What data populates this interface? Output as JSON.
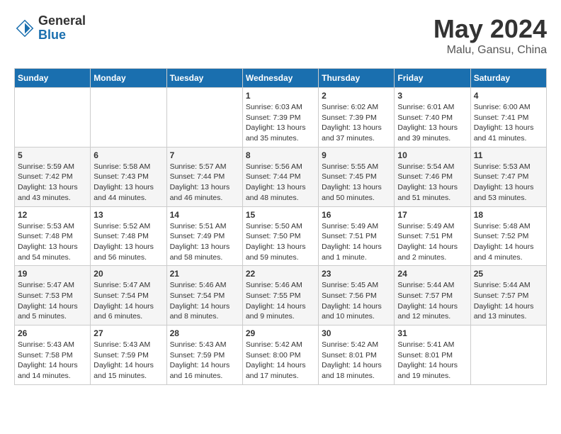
{
  "header": {
    "logo_general": "General",
    "logo_blue": "Blue",
    "title": "May 2024",
    "location": "Malu, Gansu, China"
  },
  "weekdays": [
    "Sunday",
    "Monday",
    "Tuesday",
    "Wednesday",
    "Thursday",
    "Friday",
    "Saturday"
  ],
  "weeks": [
    [
      {
        "day": "",
        "info": ""
      },
      {
        "day": "",
        "info": ""
      },
      {
        "day": "",
        "info": ""
      },
      {
        "day": "1",
        "info": "Sunrise: 6:03 AM\nSunset: 7:39 PM\nDaylight: 13 hours\nand 35 minutes."
      },
      {
        "day": "2",
        "info": "Sunrise: 6:02 AM\nSunset: 7:39 PM\nDaylight: 13 hours\nand 37 minutes."
      },
      {
        "day": "3",
        "info": "Sunrise: 6:01 AM\nSunset: 7:40 PM\nDaylight: 13 hours\nand 39 minutes."
      },
      {
        "day": "4",
        "info": "Sunrise: 6:00 AM\nSunset: 7:41 PM\nDaylight: 13 hours\nand 41 minutes."
      }
    ],
    [
      {
        "day": "5",
        "info": "Sunrise: 5:59 AM\nSunset: 7:42 PM\nDaylight: 13 hours\nand 43 minutes."
      },
      {
        "day": "6",
        "info": "Sunrise: 5:58 AM\nSunset: 7:43 PM\nDaylight: 13 hours\nand 44 minutes."
      },
      {
        "day": "7",
        "info": "Sunrise: 5:57 AM\nSunset: 7:44 PM\nDaylight: 13 hours\nand 46 minutes."
      },
      {
        "day": "8",
        "info": "Sunrise: 5:56 AM\nSunset: 7:44 PM\nDaylight: 13 hours\nand 48 minutes."
      },
      {
        "day": "9",
        "info": "Sunrise: 5:55 AM\nSunset: 7:45 PM\nDaylight: 13 hours\nand 50 minutes."
      },
      {
        "day": "10",
        "info": "Sunrise: 5:54 AM\nSunset: 7:46 PM\nDaylight: 13 hours\nand 51 minutes."
      },
      {
        "day": "11",
        "info": "Sunrise: 5:53 AM\nSunset: 7:47 PM\nDaylight: 13 hours\nand 53 minutes."
      }
    ],
    [
      {
        "day": "12",
        "info": "Sunrise: 5:53 AM\nSunset: 7:48 PM\nDaylight: 13 hours\nand 54 minutes."
      },
      {
        "day": "13",
        "info": "Sunrise: 5:52 AM\nSunset: 7:48 PM\nDaylight: 13 hours\nand 56 minutes."
      },
      {
        "day": "14",
        "info": "Sunrise: 5:51 AM\nSunset: 7:49 PM\nDaylight: 13 hours\nand 58 minutes."
      },
      {
        "day": "15",
        "info": "Sunrise: 5:50 AM\nSunset: 7:50 PM\nDaylight: 13 hours\nand 59 minutes."
      },
      {
        "day": "16",
        "info": "Sunrise: 5:49 AM\nSunset: 7:51 PM\nDaylight: 14 hours\nand 1 minute."
      },
      {
        "day": "17",
        "info": "Sunrise: 5:49 AM\nSunset: 7:51 PM\nDaylight: 14 hours\nand 2 minutes."
      },
      {
        "day": "18",
        "info": "Sunrise: 5:48 AM\nSunset: 7:52 PM\nDaylight: 14 hours\nand 4 minutes."
      }
    ],
    [
      {
        "day": "19",
        "info": "Sunrise: 5:47 AM\nSunset: 7:53 PM\nDaylight: 14 hours\nand 5 minutes."
      },
      {
        "day": "20",
        "info": "Sunrise: 5:47 AM\nSunset: 7:54 PM\nDaylight: 14 hours\nand 6 minutes."
      },
      {
        "day": "21",
        "info": "Sunrise: 5:46 AM\nSunset: 7:54 PM\nDaylight: 14 hours\nand 8 minutes."
      },
      {
        "day": "22",
        "info": "Sunrise: 5:46 AM\nSunset: 7:55 PM\nDaylight: 14 hours\nand 9 minutes."
      },
      {
        "day": "23",
        "info": "Sunrise: 5:45 AM\nSunset: 7:56 PM\nDaylight: 14 hours\nand 10 minutes."
      },
      {
        "day": "24",
        "info": "Sunrise: 5:44 AM\nSunset: 7:57 PM\nDaylight: 14 hours\nand 12 minutes."
      },
      {
        "day": "25",
        "info": "Sunrise: 5:44 AM\nSunset: 7:57 PM\nDaylight: 14 hours\nand 13 minutes."
      }
    ],
    [
      {
        "day": "26",
        "info": "Sunrise: 5:43 AM\nSunset: 7:58 PM\nDaylight: 14 hours\nand 14 minutes."
      },
      {
        "day": "27",
        "info": "Sunrise: 5:43 AM\nSunset: 7:59 PM\nDaylight: 14 hours\nand 15 minutes."
      },
      {
        "day": "28",
        "info": "Sunrise: 5:43 AM\nSunset: 7:59 PM\nDaylight: 14 hours\nand 16 minutes."
      },
      {
        "day": "29",
        "info": "Sunrise: 5:42 AM\nSunset: 8:00 PM\nDaylight: 14 hours\nand 17 minutes."
      },
      {
        "day": "30",
        "info": "Sunrise: 5:42 AM\nSunset: 8:01 PM\nDaylight: 14 hours\nand 18 minutes."
      },
      {
        "day": "31",
        "info": "Sunrise: 5:41 AM\nSunset: 8:01 PM\nDaylight: 14 hours\nand 19 minutes."
      },
      {
        "day": "",
        "info": ""
      }
    ]
  ]
}
